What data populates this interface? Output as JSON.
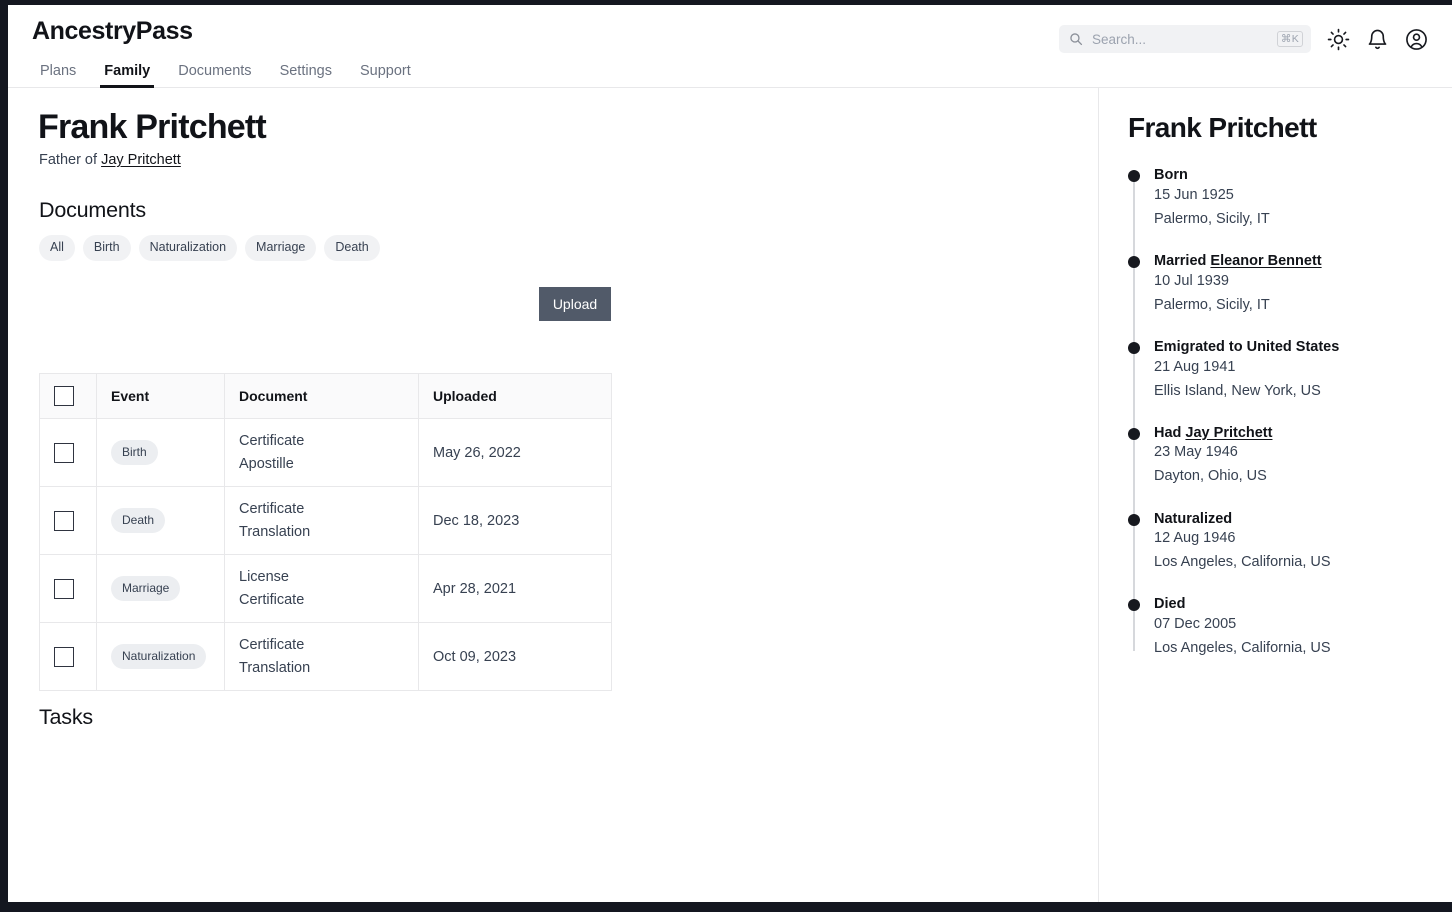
{
  "header": {
    "brand": "AncestryPass",
    "nav": [
      {
        "label": "Plans",
        "active": false
      },
      {
        "label": "Family",
        "active": true
      },
      {
        "label": "Documents",
        "active": false
      },
      {
        "label": "Settings",
        "active": false
      },
      {
        "label": "Support",
        "active": false
      }
    ],
    "search": {
      "placeholder": "Search...",
      "value": "",
      "shortcut": "⌘K",
      "icon": "search-icon"
    },
    "icons": [
      {
        "name": "brightness-sun-icon"
      },
      {
        "name": "notification-bell-icon"
      },
      {
        "name": "account-avatar-icon"
      }
    ]
  },
  "main": {
    "person_name": "Frank Pritchett",
    "relation_prefix": "Father of ",
    "relation_link": "Jay Pritchett",
    "documents_heading": "Documents",
    "upload_label": "Upload",
    "filters": [
      "All",
      "Birth",
      "Naturalization",
      "Marriage",
      "Death"
    ],
    "table": {
      "columns": [
        "",
        "Event",
        "Document",
        "Uploaded"
      ],
      "rows": [
        {
          "event": "Birth",
          "document_line1": "Certificate",
          "document_line2": "Apostille",
          "uploaded": "May 26, 2022",
          "checked": false
        },
        {
          "event": "Death",
          "document_line1": "Certificate",
          "document_line2": "Translation",
          "uploaded": "Dec 18, 2023",
          "checked": false
        },
        {
          "event": "Marriage",
          "document_line1": "License",
          "document_line2": "Certificate",
          "uploaded": "Apr 28, 2021",
          "checked": false
        },
        {
          "event": "Naturalization",
          "document_line1": "Certificate",
          "document_line2": "Translation",
          "uploaded": "Oct 09, 2023",
          "checked": false
        }
      ]
    },
    "tasks_heading": "Tasks"
  },
  "sidebar": {
    "title": "Frank Pritchett",
    "timeline": [
      {
        "title": "Born",
        "link": "",
        "date": "15 Jun 1925",
        "place": "Palermo, Sicily, IT"
      },
      {
        "title": "Married ",
        "link": "Eleanor Bennett",
        "date": "10 Jul 1939",
        "place": "Palermo, Sicily, IT"
      },
      {
        "title": "Emigrated to United States",
        "link": "",
        "date": "21 Aug 1941",
        "place": "Ellis Island, New York, US"
      },
      {
        "title": "Had ",
        "link": "Jay Pritchett",
        "date": "23 May 1946",
        "place": "Dayton, Ohio, US"
      },
      {
        "title": "Naturalized",
        "link": "",
        "date": "12 Aug 1946",
        "place": "Los Angeles, California, US"
      },
      {
        "title": "Died",
        "link": "",
        "date": "07 Dec 2005",
        "place": "Los Angeles, California, US"
      }
    ]
  },
  "colors": {
    "text_primary": "#111318",
    "text_secondary": "#374151",
    "text_muted": "#9ca3af",
    "upload_button_bg": "#515a69",
    "pill_bg": "#f1f2f4",
    "border": "#e8e8ea",
    "timeline_dot": "#17191f"
  }
}
